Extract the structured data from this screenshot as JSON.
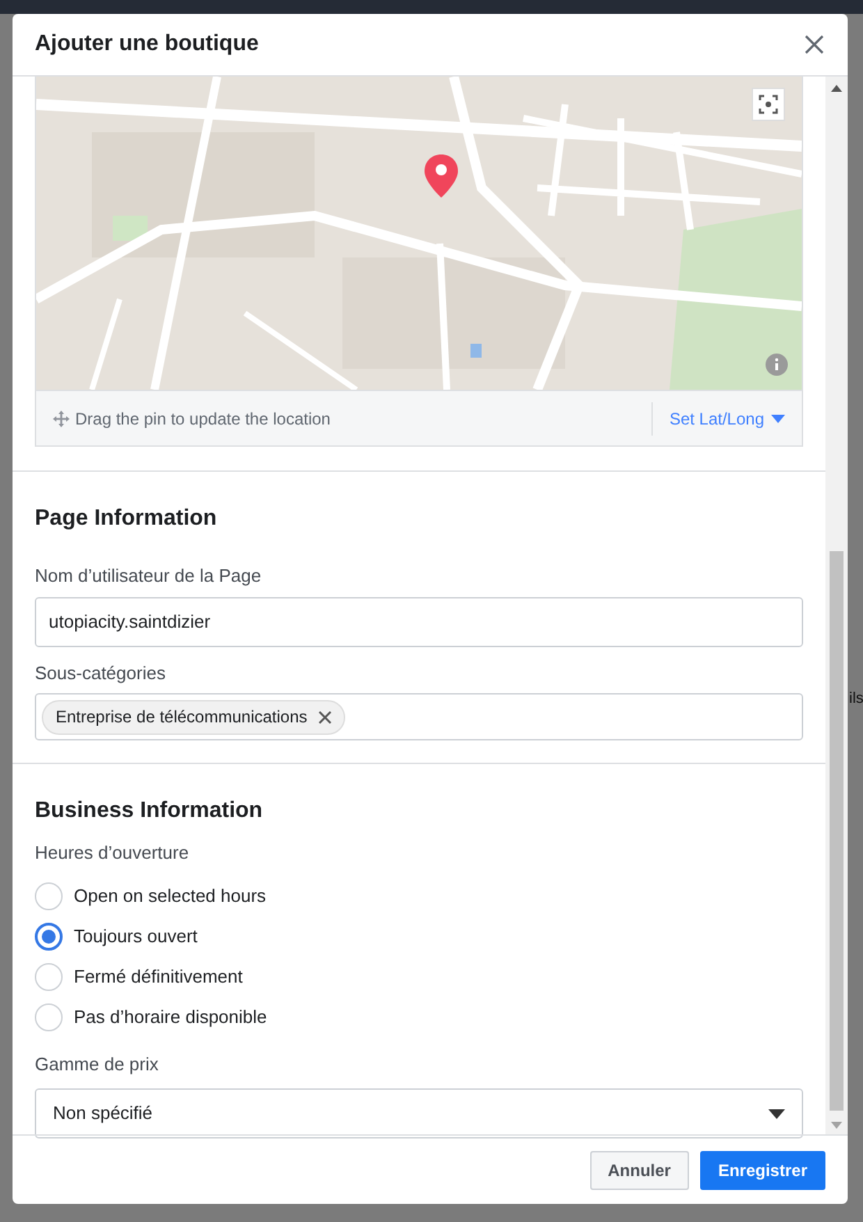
{
  "dialog": {
    "title": "Ajouter une boutique"
  },
  "map": {
    "hint": "Drag the pin to update the location",
    "latlong_link": "Set Lat/Long"
  },
  "page_information": {
    "heading": "Page Information",
    "username": {
      "label": "Nom d’utilisateur de la Page",
      "value": "utopiacity.saintdizier"
    },
    "subcategories": {
      "label": "Sous-catégories",
      "tags": [
        "Entreprise de télécommunications"
      ]
    }
  },
  "business_information": {
    "heading": "Business Information",
    "hours_label": "Heures d’ouverture",
    "hours_options": [
      {
        "label": "Open on selected hours",
        "selected": false
      },
      {
        "label": "Toujours ouvert",
        "selected": true
      },
      {
        "label": "Fermé définitivement",
        "selected": false
      },
      {
        "label": "Pas d’horaire disponible",
        "selected": false
      }
    ],
    "price_range": {
      "label": "Gamme de prix",
      "value": "Non spécifié"
    }
  },
  "buttons": [
    {
      "label": "Annuler",
      "kind": "secondary"
    },
    {
      "label": "Enregistrer",
      "kind": "primary"
    }
  ],
  "background_text": "ils"
}
